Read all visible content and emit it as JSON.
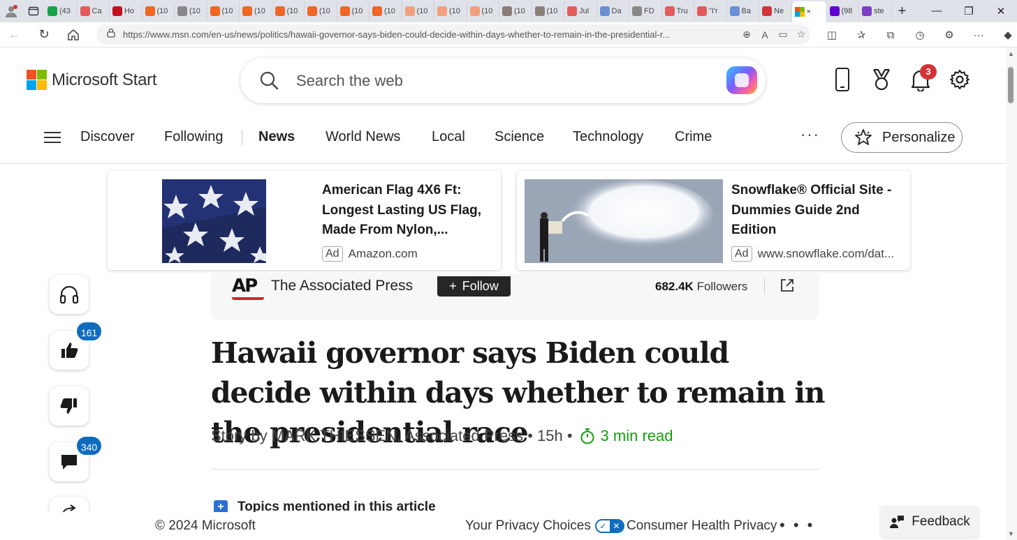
{
  "browser": {
    "tabs": [
      {
        "label": "(43",
        "color": "#16a34a"
      },
      {
        "label": "Ca",
        "color": "#e35b5b"
      },
      {
        "label": "Ho",
        "color": "#c50f1f"
      },
      {
        "label": "(10",
        "color": "#f26522"
      },
      {
        "label": "(10",
        "color": "#888888"
      },
      {
        "label": "(10",
        "color": "#f26522"
      },
      {
        "label": "(10",
        "color": "#f26522"
      },
      {
        "label": "(10",
        "color": "#f26522"
      },
      {
        "label": "(10",
        "color": "#f26522"
      },
      {
        "label": "(10",
        "color": "#f26522"
      },
      {
        "label": "(10",
        "color": "#f26522"
      },
      {
        "label": "(10",
        "color": "#f2a07b"
      },
      {
        "label": "(10",
        "color": "#f2a07b"
      },
      {
        "label": "(10",
        "color": "#f2a07b"
      },
      {
        "label": "(10",
        "color": "#8a7f76"
      },
      {
        "label": "(10",
        "color": "#8a7f76"
      },
      {
        "label": "Jul",
        "color": "#e35b5b"
      },
      {
        "label": "Da",
        "color": "#6b8fd6"
      },
      {
        "label": "FD",
        "color": "#888888"
      },
      {
        "label": "Tru",
        "color": "#e35b5b"
      },
      {
        "label": "\"I'r",
        "color": "#e35b5b"
      },
      {
        "label": "Ba",
        "color": "#6b8fd6"
      },
      {
        "label": "Ne",
        "color": "#d13438"
      }
    ],
    "active_tab": {
      "close": "×"
    },
    "tabs_after": [
      {
        "label": "(98",
        "color": "#6001d2"
      },
      {
        "label": "ste",
        "color": "#7b3fc4"
      }
    ],
    "url": "https://www.msn.com/en-us/news/politics/hawaii-governor-says-biden-could-decide-within-days-whether-to-remain-in-the-presidential-r..."
  },
  "header": {
    "logo_text": "Microsoft Start",
    "search_placeholder": "Search the web",
    "notification_count": "3",
    "brand_colors": [
      "#f25022",
      "#7fba00",
      "#00a4ef",
      "#ffb900"
    ]
  },
  "nav": {
    "items": [
      "Discover",
      "Following",
      "News",
      "World News",
      "Local",
      "Science",
      "Technology",
      "Crime"
    ],
    "active": "News",
    "more": "···",
    "personalize": "Personalize"
  },
  "ads": [
    {
      "title": "American Flag 4X6 Ft: Longest Lasting US Flag, Made From Nylon,...",
      "tag": "Ad",
      "source": "Amazon.com"
    },
    {
      "title": "Snowflake® Official Site - Dummies Guide 2nd Edition",
      "tag": "Ad",
      "source": "www.snowflake.com/dat..."
    }
  ],
  "rail": {
    "like_count": "161",
    "comment_count": "340"
  },
  "article": {
    "publisher": "The Associated Press",
    "publisher_logo": "AP",
    "follow_label": "Follow",
    "followers_count": "682.4K",
    "followers_label": "Followers",
    "headline": "Hawaii governor says Biden could decide within days whether to remain in the presidential race",
    "byline": "Story by MARK THIESSEN, Associated Press • 15h •",
    "read_time": "3 min read",
    "topics_label": "Topics mentioned in this article"
  },
  "footer": {
    "copyright": "© 2024 Microsoft",
    "privacy_choices": "Your Privacy Choices",
    "health_privacy": "Consumer Health Privacy",
    "more": "• • •",
    "feedback": "Feedback"
  },
  "colors": {
    "accent_blue": "#0f6cbd",
    "read_time_green": "#13a10e",
    "notification_red": "#d13438"
  }
}
